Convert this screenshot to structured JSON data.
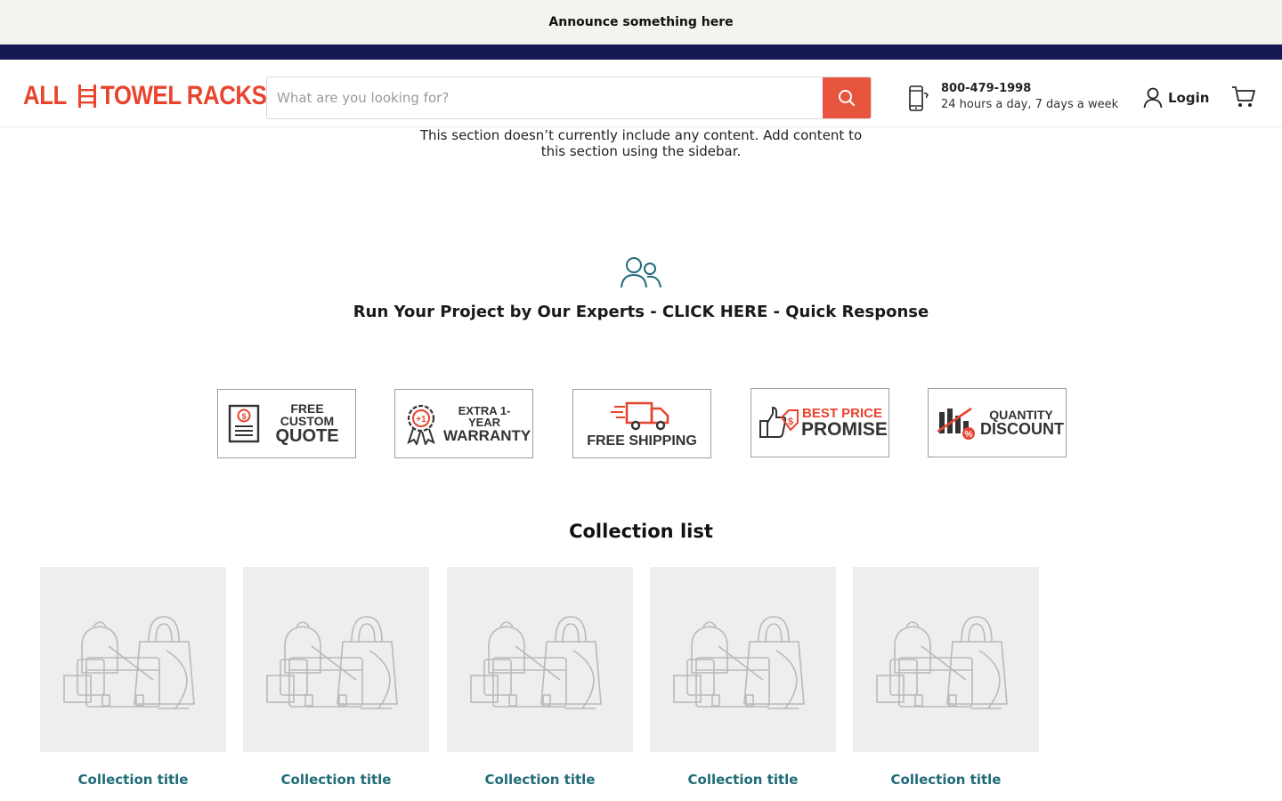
{
  "announcement": {
    "text": "Announce something here"
  },
  "header": {
    "logo": {
      "left_word": "ALL",
      "right_word": "TOWEL RACKS"
    },
    "search": {
      "placeholder": "What are you looking for?",
      "value": ""
    },
    "phone": {
      "number": "800-479-1998",
      "hours": "24 hours a day, 7 days a week"
    },
    "login_label": "Login"
  },
  "empty_section": {
    "text": "This section doesn’t currently include any content. Add content to this section using the sidebar."
  },
  "experts": {
    "text": "Run Your Project by Our Experts - CLICK HERE - Quick Response"
  },
  "badges": [
    {
      "line1": "FREE CUSTOM",
      "line2": "QUOTE",
      "icon": "document-dollar-icon"
    },
    {
      "line1": "EXTRA 1-YEAR",
      "line2": "WARRANTY",
      "icon": "award-ribbon-icon"
    },
    {
      "line1": "FREE SHIPPING",
      "line2": "",
      "icon": "delivery-truck-icon"
    },
    {
      "line1": "BEST PRICE",
      "line2": "PROMISE",
      "icon": "thumbs-up-price-tag-icon"
    },
    {
      "line1": "QUANTITY",
      "line2": "DISCOUNT",
      "icon": "bar-chart-discount-icon"
    }
  ],
  "collection_list": {
    "heading": "Collection list",
    "items": [
      {
        "title": "Collection title"
      },
      {
        "title": "Collection title"
      },
      {
        "title": "Collection title"
      },
      {
        "title": "Collection title"
      },
      {
        "title": "Collection title"
      }
    ]
  },
  "colors": {
    "announcement_bg": "#f4f3ef",
    "navy_bar": "#151a55",
    "brand_red": "#e8442e",
    "search_button": "#e8553f",
    "collection_title": "#1f6b78",
    "experts_icon": "#1f6b78",
    "placeholder_bg": "#eeeeee"
  }
}
